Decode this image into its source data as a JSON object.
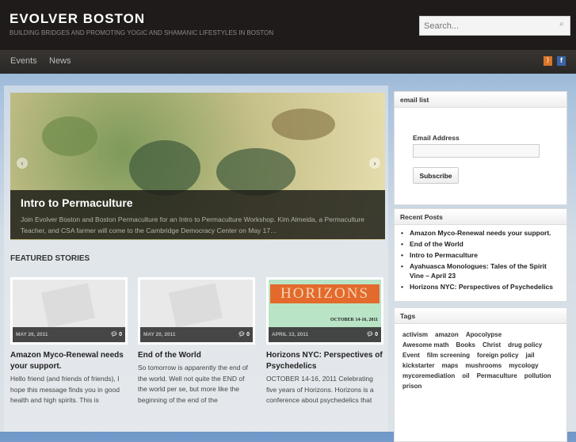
{
  "site": {
    "title": "EVOLVER BOSTON",
    "tagline": "BUILDING BRIDGES AND PROMOTING YOGIC AND SHAMANIC LIFESTYLES IN BOSTON",
    "search_placeholder": "Search..."
  },
  "nav": {
    "items": [
      "Events",
      "News"
    ]
  },
  "slider": {
    "title": "Intro to Permaculture",
    "excerpt": "Join Evolver Boston and Boston Permaculture for an Intro to Permaculture Workshop. Kim Almeida, a Permaculture Teacher, and CSA farmer will come to the Cambridge Democracy Center on May 17…",
    "prev": "‹",
    "next": "›"
  },
  "featured": {
    "heading": "FEATURED STORIES",
    "stories": [
      {
        "date": "MAY 26, 2011",
        "comments": "0",
        "title": "Amazon Myco-Renewal needs your support.",
        "excerpt": "Hello friend (and friends of friends), I hope this message finds you in good health and high spirits.  This is"
      },
      {
        "date": "MAY 20, 2011",
        "comments": "0",
        "title": "End of the World",
        "excerpt": "So tomorrow is apparently the end of the world. Well not quite the END of the world per se, but more like the beginning of the end of the"
      },
      {
        "date": "APRIL 13, 2011",
        "comments": "0",
        "title": "Horizons NYC: Perspectives of Psychedelics",
        "excerpt": "OCTOBER 14-16, 2011 Celebrating five years of Horizons. Horizons is a conference about psychedelics that",
        "image_text": "HORIZONS",
        "image_date": "OCTOBER 14-16, 2011"
      }
    ]
  },
  "sidebar": {
    "email": {
      "title": "email list",
      "label": "Email Address",
      "button": "Subscribe"
    },
    "recent": {
      "title": "Recent Posts",
      "items": [
        "Amazon Myco-Renewal needs your support.",
        "End of the World",
        "Intro to Permaculture",
        "Ayahuasca Monologues: Tales of the Spirit Vine – April 23",
        "Horizons NYC: Perspectives of Psychedelics"
      ]
    },
    "tags": {
      "title": "Tags",
      "items": [
        "activism",
        "amazon",
        "Apocolypse",
        "Awesome math",
        "Books",
        "Christ",
        "drug policy",
        "Event",
        "film screening",
        "foreign policy",
        "jail",
        "kickstarter",
        "maps",
        "mushrooms",
        "mycology",
        "mycoremediation",
        "oil",
        "Permaculture",
        "pollution",
        "prison"
      ]
    }
  }
}
